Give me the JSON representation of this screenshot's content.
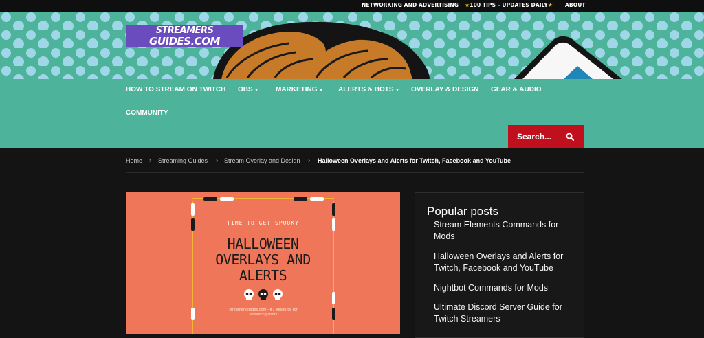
{
  "topbar": {
    "networking": "NETWORKING AND ADVERTISING",
    "tips": "100 TIPS – UPDATES DAILY",
    "about": "ABOUT"
  },
  "logo": {
    "line1": "STREAMERS",
    "line2": "GUIDES.COM"
  },
  "nav": {
    "items": [
      {
        "label": "HOW TO STREAM ON TWITCH"
      },
      {
        "label": "OBS"
      },
      {
        "label": "MARKETING"
      },
      {
        "label": "ALERTS & BOTS"
      },
      {
        "label": "OVERLAY & DESIGN"
      },
      {
        "label": "GEAR & AUDIO"
      },
      {
        "label": "COMMUNITY"
      }
    ],
    "search_placeholder": "Search..."
  },
  "breadcrumb": {
    "items": [
      "Home",
      "Streaming Guides",
      "Stream Overlay and Design"
    ],
    "current": "Halloween Overlays and Alerts for Twitch, Facebook and YouTube"
  },
  "feature_image": {
    "subtitle": "TIME TO GET SPOOKY",
    "title_lines": [
      "HALLOWEEN",
      "OVERLAYS AND",
      "ALERTS"
    ],
    "footer": "streamersguides.com - #1 Resource for streaming stuffs"
  },
  "sidebar": {
    "title": "Popular posts",
    "posts": [
      "Stream Elements Commands for Mods",
      "Halloween Overlays and Alerts for Twitch, Facebook and YouTube",
      "Nightbot Commands for Mods",
      "Ultimate Discord Server Guide for Twitch Streamers"
    ]
  },
  "colors": {
    "teal": "#4db39a",
    "dark": "#141414",
    "search_red": "#c0101e",
    "logo_purple": "#6a4cbf",
    "feature_orange": "#f0765a"
  }
}
